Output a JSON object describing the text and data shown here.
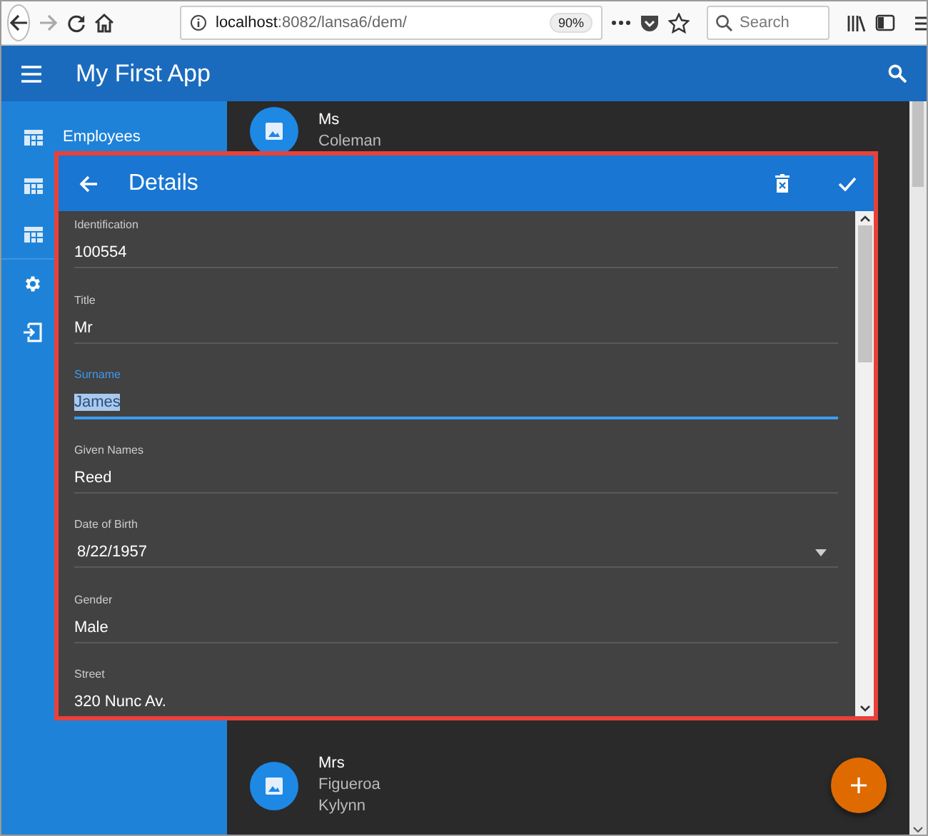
{
  "browser": {
    "url_host": "localhost",
    "url_rest": ":8082/lansa6/dem/",
    "zoom": "90%",
    "search": {
      "placeholder": "Search"
    }
  },
  "app_bar": {
    "title": "My First App"
  },
  "sidebar": {
    "items": [
      {
        "kind": "grid",
        "label": "Employees"
      },
      {
        "kind": "grid"
      },
      {
        "kind": "grid"
      },
      {
        "kind": "settings"
      },
      {
        "kind": "exit"
      }
    ]
  },
  "list": {
    "items": [
      {
        "lines": [
          "Ms",
          "Coleman"
        ]
      },
      {
        "lines": [
          "Mrs",
          "Figueroa",
          "Kylynn"
        ]
      }
    ]
  },
  "dialog": {
    "title": "Details",
    "fields": [
      {
        "kind": "text",
        "label": "Identification",
        "value": "100554",
        "focused": false
      },
      {
        "kind": "text",
        "label": "Title",
        "value": "Mr",
        "focused": false
      },
      {
        "kind": "text",
        "label": "Surname",
        "value": "James",
        "focused": true
      },
      {
        "kind": "text",
        "label": "Given Names",
        "value": "Reed",
        "focused": false
      },
      {
        "kind": "date",
        "label": "Date of Birth",
        "value": "8/22/1957",
        "focused": false
      },
      {
        "kind": "text",
        "label": "Gender",
        "value": "Male",
        "focused": false
      },
      {
        "kind": "text",
        "label": "Street",
        "value": "320 Nunc Av.",
        "focused": false
      }
    ]
  }
}
